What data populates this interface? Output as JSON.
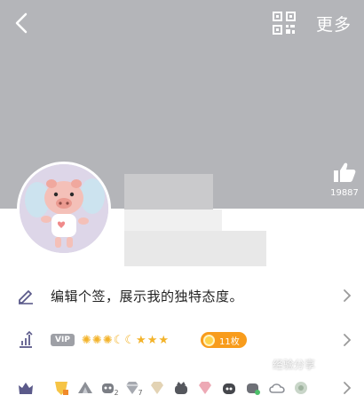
{
  "header": {
    "back_icon": "chevron-left-icon",
    "qr_icon": "qr-code-icon",
    "more_label": "更多"
  },
  "cover": {
    "background": "#b4b5b9"
  },
  "like": {
    "icon": "thumbs-up-icon",
    "count": "19887"
  },
  "profile": {
    "avatar": "pig-avatar"
  },
  "rows": {
    "signature": {
      "icon": "pencil-icon",
      "text": "编辑个签，展示我的独特态度。",
      "chevron": "chevron-right-icon"
    },
    "level": {
      "icon": "level-up-icon",
      "vip_label": "VIP",
      "level_icons": [
        "sun",
        "sun",
        "sun",
        "moon",
        "moon",
        "star",
        "star",
        "star"
      ],
      "coin_label": "11枚",
      "chevron": "chevron-right-icon"
    },
    "medals": {
      "icon": "crown-icon",
      "count_labels": [
        "2",
        "7"
      ],
      "chevron": "chevron-right-icon"
    }
  },
  "watermark": "经验分享",
  "colors": {
    "accent_orange": "#f89c1c",
    "star_gold": "#f3b32a",
    "text_dark": "#222222",
    "icon_purple": "#5b5a8a"
  }
}
